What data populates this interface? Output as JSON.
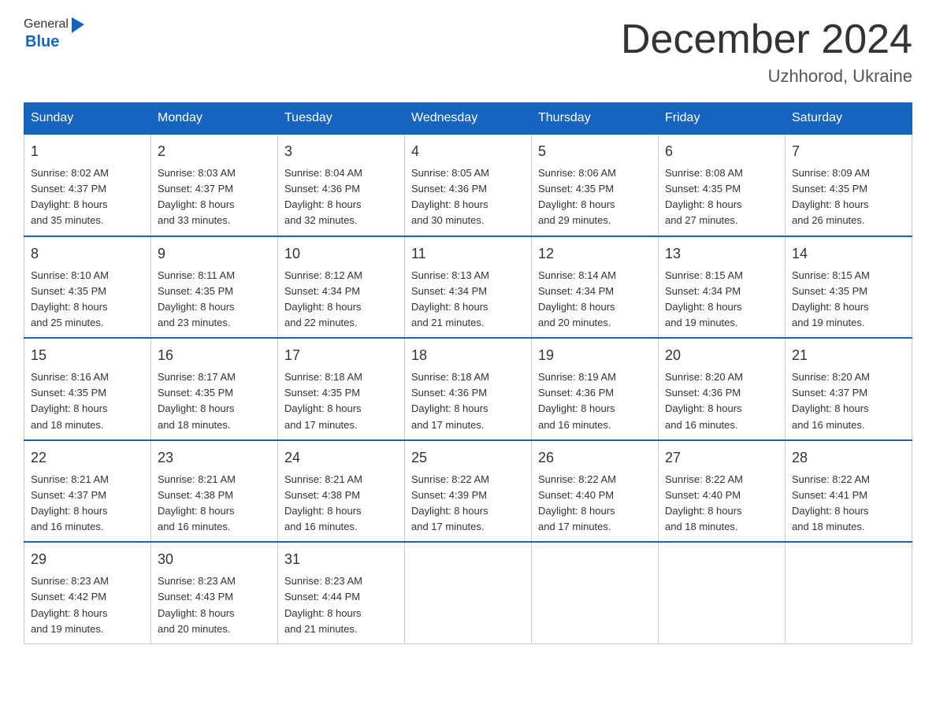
{
  "header": {
    "logo_general": "General",
    "logo_blue": "Blue",
    "month": "December 2024",
    "location": "Uzhhorod, Ukraine"
  },
  "days_of_week": [
    "Sunday",
    "Monday",
    "Tuesday",
    "Wednesday",
    "Thursday",
    "Friday",
    "Saturday"
  ],
  "weeks": [
    [
      {
        "day": "1",
        "sunrise": "Sunrise: 8:02 AM",
        "sunset": "Sunset: 4:37 PM",
        "daylight": "Daylight: 8 hours",
        "minutes": "and 35 minutes."
      },
      {
        "day": "2",
        "sunrise": "Sunrise: 8:03 AM",
        "sunset": "Sunset: 4:37 PM",
        "daylight": "Daylight: 8 hours",
        "minutes": "and 33 minutes."
      },
      {
        "day": "3",
        "sunrise": "Sunrise: 8:04 AM",
        "sunset": "Sunset: 4:36 PM",
        "daylight": "Daylight: 8 hours",
        "minutes": "and 32 minutes."
      },
      {
        "day": "4",
        "sunrise": "Sunrise: 8:05 AM",
        "sunset": "Sunset: 4:36 PM",
        "daylight": "Daylight: 8 hours",
        "minutes": "and 30 minutes."
      },
      {
        "day": "5",
        "sunrise": "Sunrise: 8:06 AM",
        "sunset": "Sunset: 4:35 PM",
        "daylight": "Daylight: 8 hours",
        "minutes": "and 29 minutes."
      },
      {
        "day": "6",
        "sunrise": "Sunrise: 8:08 AM",
        "sunset": "Sunset: 4:35 PM",
        "daylight": "Daylight: 8 hours",
        "minutes": "and 27 minutes."
      },
      {
        "day": "7",
        "sunrise": "Sunrise: 8:09 AM",
        "sunset": "Sunset: 4:35 PM",
        "daylight": "Daylight: 8 hours",
        "minutes": "and 26 minutes."
      }
    ],
    [
      {
        "day": "8",
        "sunrise": "Sunrise: 8:10 AM",
        "sunset": "Sunset: 4:35 PM",
        "daylight": "Daylight: 8 hours",
        "minutes": "and 25 minutes."
      },
      {
        "day": "9",
        "sunrise": "Sunrise: 8:11 AM",
        "sunset": "Sunset: 4:35 PM",
        "daylight": "Daylight: 8 hours",
        "minutes": "and 23 minutes."
      },
      {
        "day": "10",
        "sunrise": "Sunrise: 8:12 AM",
        "sunset": "Sunset: 4:34 PM",
        "daylight": "Daylight: 8 hours",
        "minutes": "and 22 minutes."
      },
      {
        "day": "11",
        "sunrise": "Sunrise: 8:13 AM",
        "sunset": "Sunset: 4:34 PM",
        "daylight": "Daylight: 8 hours",
        "minutes": "and 21 minutes."
      },
      {
        "day": "12",
        "sunrise": "Sunrise: 8:14 AM",
        "sunset": "Sunset: 4:34 PM",
        "daylight": "Daylight: 8 hours",
        "minutes": "and 20 minutes."
      },
      {
        "day": "13",
        "sunrise": "Sunrise: 8:15 AM",
        "sunset": "Sunset: 4:34 PM",
        "daylight": "Daylight: 8 hours",
        "minutes": "and 19 minutes."
      },
      {
        "day": "14",
        "sunrise": "Sunrise: 8:15 AM",
        "sunset": "Sunset: 4:35 PM",
        "daylight": "Daylight: 8 hours",
        "minutes": "and 19 minutes."
      }
    ],
    [
      {
        "day": "15",
        "sunrise": "Sunrise: 8:16 AM",
        "sunset": "Sunset: 4:35 PM",
        "daylight": "Daylight: 8 hours",
        "minutes": "and 18 minutes."
      },
      {
        "day": "16",
        "sunrise": "Sunrise: 8:17 AM",
        "sunset": "Sunset: 4:35 PM",
        "daylight": "Daylight: 8 hours",
        "minutes": "and 18 minutes."
      },
      {
        "day": "17",
        "sunrise": "Sunrise: 8:18 AM",
        "sunset": "Sunset: 4:35 PM",
        "daylight": "Daylight: 8 hours",
        "minutes": "and 17 minutes."
      },
      {
        "day": "18",
        "sunrise": "Sunrise: 8:18 AM",
        "sunset": "Sunset: 4:36 PM",
        "daylight": "Daylight: 8 hours",
        "minutes": "and 17 minutes."
      },
      {
        "day": "19",
        "sunrise": "Sunrise: 8:19 AM",
        "sunset": "Sunset: 4:36 PM",
        "daylight": "Daylight: 8 hours",
        "minutes": "and 16 minutes."
      },
      {
        "day": "20",
        "sunrise": "Sunrise: 8:20 AM",
        "sunset": "Sunset: 4:36 PM",
        "daylight": "Daylight: 8 hours",
        "minutes": "and 16 minutes."
      },
      {
        "day": "21",
        "sunrise": "Sunrise: 8:20 AM",
        "sunset": "Sunset: 4:37 PM",
        "daylight": "Daylight: 8 hours",
        "minutes": "and 16 minutes."
      }
    ],
    [
      {
        "day": "22",
        "sunrise": "Sunrise: 8:21 AM",
        "sunset": "Sunset: 4:37 PM",
        "daylight": "Daylight: 8 hours",
        "minutes": "and 16 minutes."
      },
      {
        "day": "23",
        "sunrise": "Sunrise: 8:21 AM",
        "sunset": "Sunset: 4:38 PM",
        "daylight": "Daylight: 8 hours",
        "minutes": "and 16 minutes."
      },
      {
        "day": "24",
        "sunrise": "Sunrise: 8:21 AM",
        "sunset": "Sunset: 4:38 PM",
        "daylight": "Daylight: 8 hours",
        "minutes": "and 16 minutes."
      },
      {
        "day": "25",
        "sunrise": "Sunrise: 8:22 AM",
        "sunset": "Sunset: 4:39 PM",
        "daylight": "Daylight: 8 hours",
        "minutes": "and 17 minutes."
      },
      {
        "day": "26",
        "sunrise": "Sunrise: 8:22 AM",
        "sunset": "Sunset: 4:40 PM",
        "daylight": "Daylight: 8 hours",
        "minutes": "and 17 minutes."
      },
      {
        "day": "27",
        "sunrise": "Sunrise: 8:22 AM",
        "sunset": "Sunset: 4:40 PM",
        "daylight": "Daylight: 8 hours",
        "minutes": "and 18 minutes."
      },
      {
        "day": "28",
        "sunrise": "Sunrise: 8:22 AM",
        "sunset": "Sunset: 4:41 PM",
        "daylight": "Daylight: 8 hours",
        "minutes": "and 18 minutes."
      }
    ],
    [
      {
        "day": "29",
        "sunrise": "Sunrise: 8:23 AM",
        "sunset": "Sunset: 4:42 PM",
        "daylight": "Daylight: 8 hours",
        "minutes": "and 19 minutes."
      },
      {
        "day": "30",
        "sunrise": "Sunrise: 8:23 AM",
        "sunset": "Sunset: 4:43 PM",
        "daylight": "Daylight: 8 hours",
        "minutes": "and 20 minutes."
      },
      {
        "day": "31",
        "sunrise": "Sunrise: 8:23 AM",
        "sunset": "Sunset: 4:44 PM",
        "daylight": "Daylight: 8 hours",
        "minutes": "and 21 minutes."
      },
      null,
      null,
      null,
      null
    ]
  ]
}
